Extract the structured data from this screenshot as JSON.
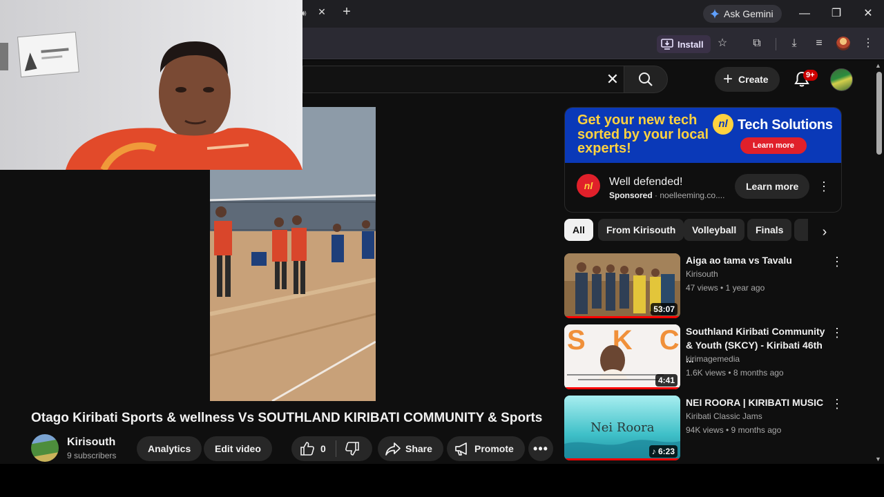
{
  "browser": {
    "gemini_label": "Ask Gemini",
    "install_label": "Install",
    "window_controls": [
      "minimize-icon",
      "restore-icon",
      "close-icon"
    ],
    "toolbar_icons": [
      "star-icon",
      "screen-search-icon",
      "download-icon",
      "media-queue-icon",
      "profile-avatar",
      "kebab-menu-icon"
    ]
  },
  "header": {
    "create_label": "Create",
    "notification_count": "9+"
  },
  "video": {
    "title": "Otago Kiribati Sports & wellness Vs SOUTHLAND KIRIBATI COMMUNITY & Sports",
    "channel": "Kirisouth",
    "subscribers": "9 subscribers",
    "analytics_label": "Analytics",
    "edit_label": "Edit video",
    "likes": "0",
    "share_label": "Share",
    "promote_label": "Promote"
  },
  "ad": {
    "headline": "Get your new tech sorted by your local experts!",
    "brand": "Tech Solutions",
    "brand_logo_text": "nl",
    "banner_cta": "Learn more",
    "title": "Well defended!",
    "sponsored": "Sponsored",
    "domain": "noelleeming.co....",
    "cta": "Learn more"
  },
  "chips": [
    "All",
    "From Kirisouth",
    "Volleyball",
    "Finals"
  ],
  "related": [
    {
      "title": "Aiga ao tama vs Tavalu",
      "channel": "Kirisouth",
      "meta": "47 views • 1 year ago",
      "duration": "53:07",
      "watched": 1.0
    },
    {
      "title": "Southland Kiribati Community & Youth (SKCY) - Kiribati 46th ...",
      "channel": "kirimagemedia",
      "meta": "1.6K views • 8 months ago",
      "duration": "4:41",
      "watched": 1.0,
      "thumb_text": "S K C Y"
    },
    {
      "title": "NEI ROORA | KIRIBATI MUSIC",
      "channel": "Kiribati Classic Jams",
      "meta": "94K views • 9 months ago",
      "duration": "6:23",
      "watched": 1.0,
      "thumb_text": "Nei Roora"
    }
  ],
  "colors": {
    "page_bg": "#0f0f0f",
    "pill_bg": "#272727",
    "ad_blue": "#0a39b8",
    "ad_yellow": "#ffd23f",
    "ad_red": "#e0202a",
    "progress_red": "#ff0000"
  }
}
